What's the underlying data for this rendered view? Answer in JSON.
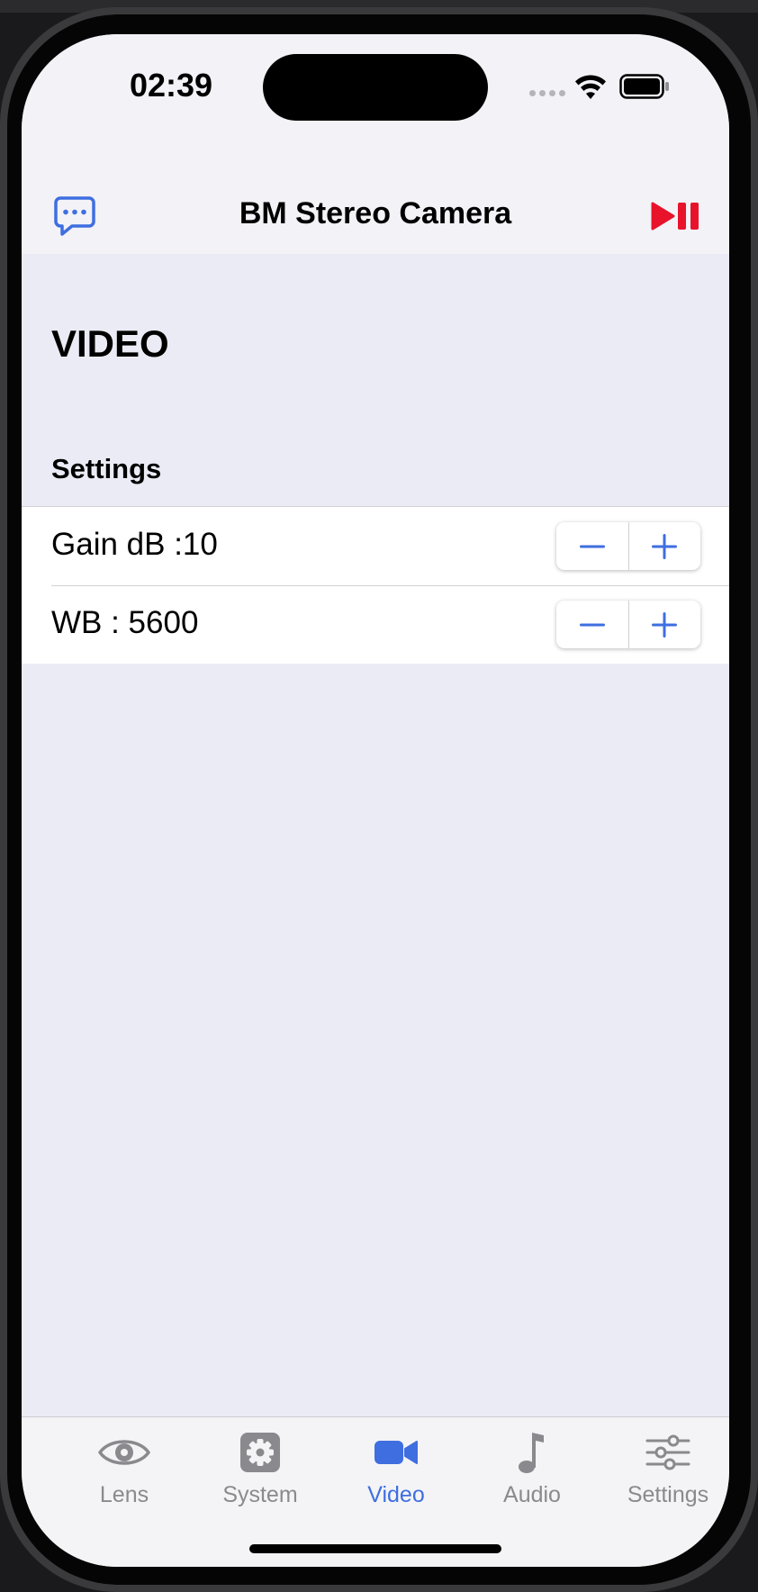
{
  "status_bar": {
    "time": "02:39"
  },
  "nav": {
    "title": "BM Stereo Camera"
  },
  "page": {
    "title": "VIDEO",
    "section_header": "Settings"
  },
  "settings": [
    {
      "label": "Gain dB :10"
    },
    {
      "label": "WB : 5600"
    }
  ],
  "tabs": [
    {
      "label": "Lens",
      "icon": "eye-icon",
      "active": false
    },
    {
      "label": "System",
      "icon": "gear-icon",
      "active": false
    },
    {
      "label": "Video",
      "icon": "video-camera-icon",
      "active": true
    },
    {
      "label": "Audio",
      "icon": "music-note-icon",
      "active": false
    },
    {
      "label": "Settings",
      "icon": "sliders-icon",
      "active": false
    }
  ],
  "colors": {
    "accent": "#3e6ee0",
    "record": "#e8132b",
    "inactive_tab": "#8a8a8e",
    "background": "#ebebf5"
  }
}
